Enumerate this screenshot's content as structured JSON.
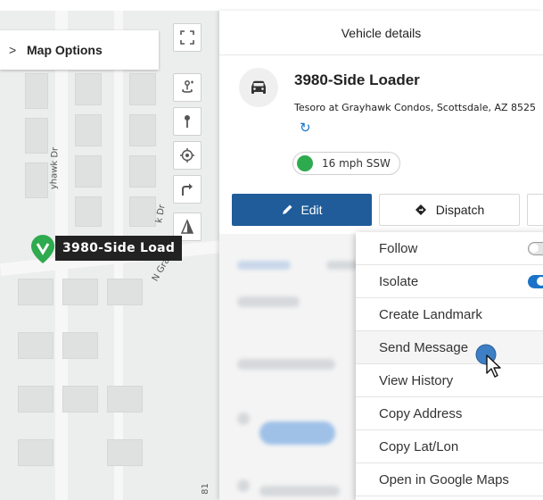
{
  "map": {
    "options_label": "Map Options",
    "street_labels": [
      "yhawk Dr",
      "N Gray",
      "k Dr",
      "81"
    ],
    "vehicle_label": "3980-Side Load",
    "vehicle_pin_color": "#2eaa4f",
    "tools": [
      {
        "icon": "fullscreen-icon"
      },
      {
        "icon": "street-view-icon"
      },
      {
        "icon": "map-pin-icon"
      },
      {
        "icon": "locate-icon"
      },
      {
        "icon": "directions-icon"
      },
      {
        "icon": "navigation-arrow-icon"
      }
    ]
  },
  "panel": {
    "title": "Vehicle details",
    "vehicle_name": "3980-Side Loader",
    "address": "Tesoro at Grayhawk Condos, Scottsdale, AZ 8525",
    "speed": "16 mph SSW",
    "speed_status_color": "#2eaa4f",
    "edit_label": "Edit",
    "dispatch_label": "Dispatch",
    "primary_color": "#1f5c99"
  },
  "menu": {
    "items": [
      {
        "label": "Follow",
        "toggle": "off"
      },
      {
        "label": "Isolate",
        "toggle": "on"
      },
      {
        "label": "Create Landmark"
      },
      {
        "label": "Send Message"
      },
      {
        "label": "View History"
      },
      {
        "label": "Copy Address"
      },
      {
        "label": "Copy Lat/Lon"
      },
      {
        "label": "Open in Google Maps"
      }
    ]
  }
}
